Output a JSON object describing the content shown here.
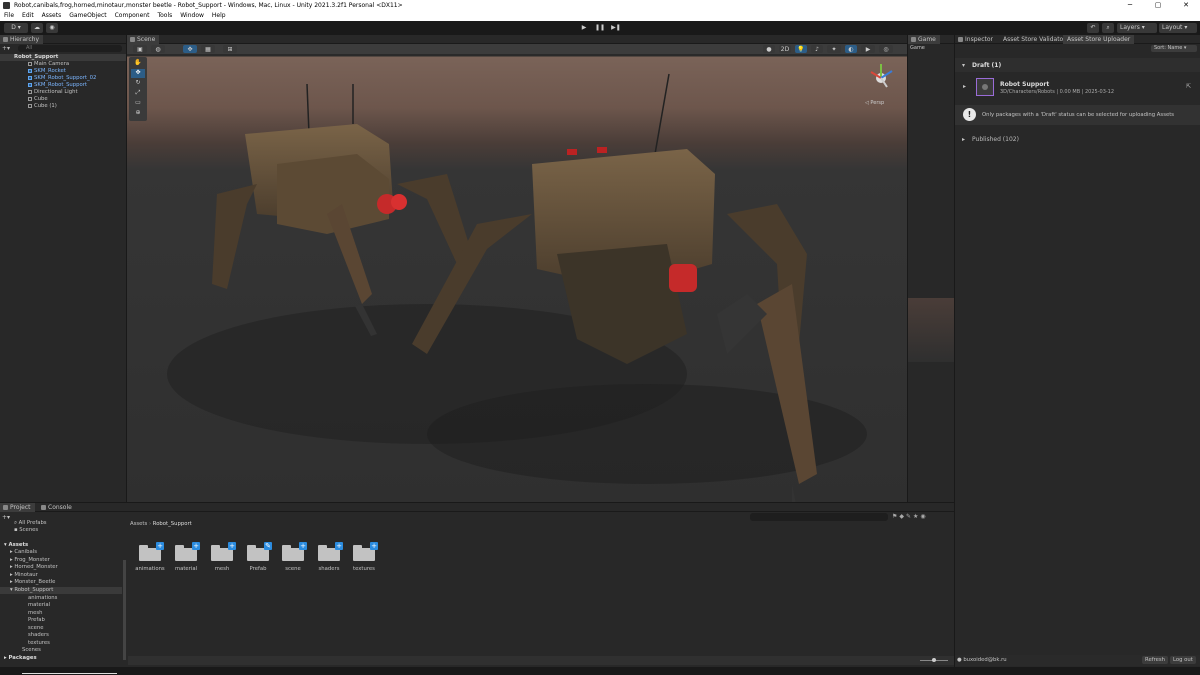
{
  "window": {
    "title": "Robot,canibals,frog,horned,minotaur,monster beetle - Robot_Support - Windows, Mac, Linux - Unity 2021.3.2f1 Personal <DX11>",
    "min": "─",
    "max": "▢",
    "close": "✕"
  },
  "menu": [
    "File",
    "Edit",
    "Assets",
    "GameObject",
    "Component",
    "Tools",
    "Window",
    "Help"
  ],
  "toolbar": {
    "account": "D ▾",
    "play": "▶",
    "pause": "❚❚",
    "step": "▶❚",
    "layers": "Layers",
    "layout": "Layout"
  },
  "hierarchy": {
    "tab": "Hierarchy",
    "search_placeholder": "All",
    "scene": "Robot_Support",
    "items": [
      "Main Camera",
      "SKM_Rocket",
      "SKM_Robot_Support_02",
      "SKM_Robot_Support",
      "Directional Light",
      "Cube",
      "Cube (1)"
    ]
  },
  "scene": {
    "tab": "Scene",
    "mode2d": "2D",
    "persp": "◁ Persp"
  },
  "game": {
    "tab": "Game",
    "display": "Game"
  },
  "inspector": {
    "tabs": [
      "Inspector",
      "Asset Store Validator",
      "Asset Store Uploader"
    ],
    "sort": "Sort: Name ▾",
    "draft": "Draft (1)",
    "package": {
      "name": "Robot Support",
      "meta": "3D/Characters/Robots | 0.00 MB | 2025-03-12"
    },
    "notice": "Only packages with a 'Draft' status can be selected for uploading Assets",
    "published": "Published (102)"
  },
  "project": {
    "tabs": [
      "Project",
      "Console"
    ],
    "favorites": [
      "All Prefabs",
      "Scenes"
    ],
    "tree_root": "Assets",
    "tree": [
      "Canibals",
      "Frog_Monster",
      "Horned_Monster",
      "Minotaur",
      "Monster_Beetle",
      "Robot_Support"
    ],
    "sub": [
      "animations",
      "material",
      "mesh",
      "Prefab",
      "scene",
      "shaders",
      "textures"
    ],
    "tail": [
      "Scenes"
    ],
    "packages": "Packages",
    "breadcrumb": [
      "Assets",
      "Robot_Support"
    ],
    "folders": [
      "animations",
      "material",
      "mesh",
      "Prefab",
      "scene",
      "shaders",
      "textures"
    ]
  },
  "status": {
    "user": "buxoided@bk.ru",
    "refresh": "Refresh",
    "logout": "Log out"
  }
}
